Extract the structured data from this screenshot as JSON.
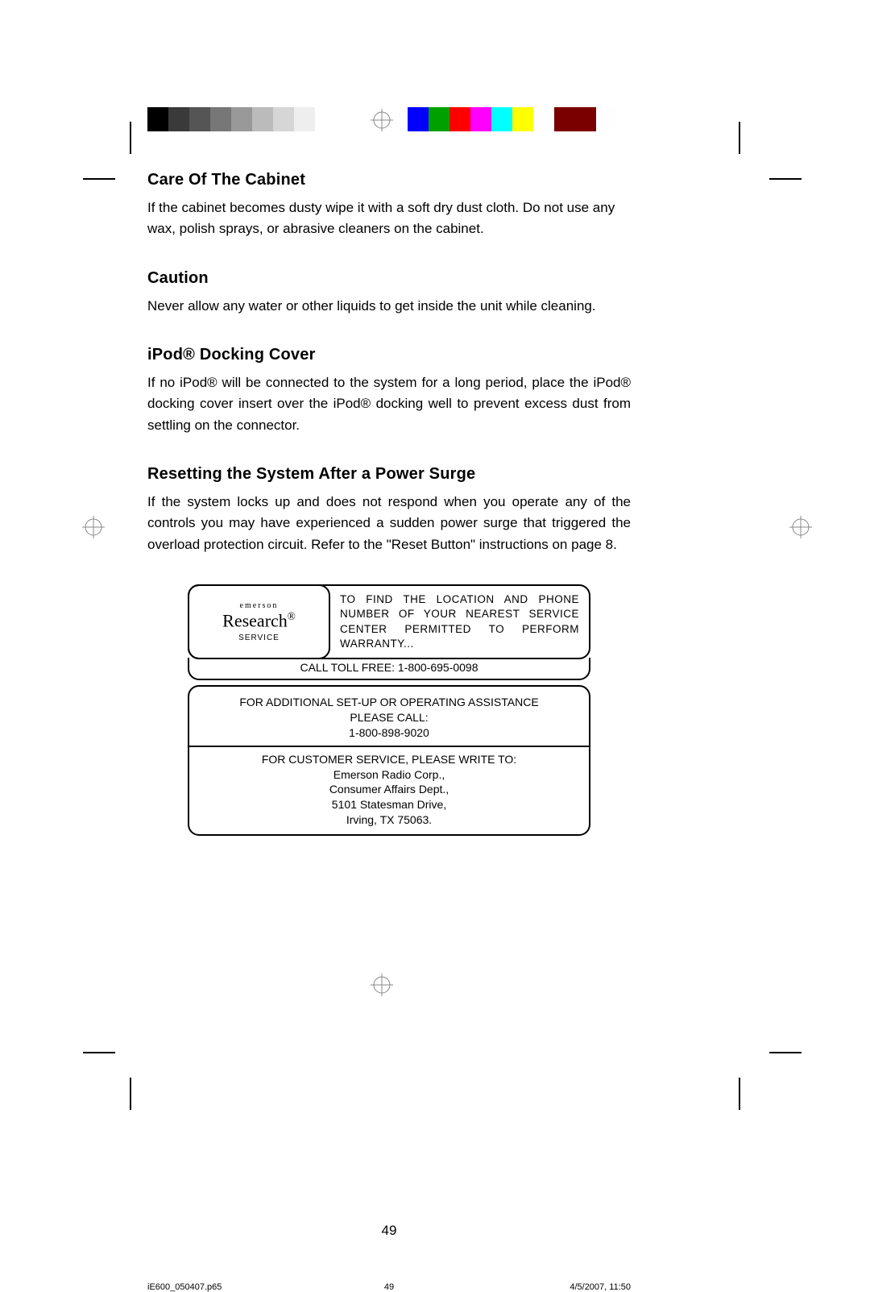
{
  "colors": {
    "left_bar": [
      "#000000",
      "#3a3a3a",
      "#555555",
      "#777777",
      "#999999",
      "#bbbbbb",
      "#d6d6d6",
      "#eeeeee",
      "#ffffff",
      "#ffffff"
    ],
    "right_bar": [
      "#0000ff",
      "#00a000",
      "#ff0000",
      "#ff00ff",
      "#00ffff",
      "#ffff00",
      "#ffffff",
      "#7a0000",
      "#7a0000",
      "#fefefe"
    ]
  },
  "sections": [
    {
      "heading": "Care Of The Cabinet",
      "body": "If the cabinet becomes dusty wipe it with a soft dry dust cloth.  Do not use any wax, polish sprays, or abrasive cleaners on the cabinet.",
      "justify": false
    },
    {
      "heading": "Caution",
      "body": "Never allow any water or other liquids to get inside the unit while cleaning.",
      "justify": false
    },
    {
      "heading": "iPod® Docking Cover",
      "body": "If no iPod® will be connected to the system for a long period, place the iPod® docking cover insert over the iPod® docking well to prevent excess dust from settling on the connector.",
      "justify": true
    },
    {
      "heading": "Resetting the System After a Power Surge",
      "body": "If the system locks up and does not respond when you operate any of the controls you may have experienced a sudden power surge that triggered the overload protection circuit.  Refer to the \"Reset Button\" instructions on page 8.",
      "justify": true
    }
  ],
  "service_box": {
    "logo": {
      "line1": "emerson",
      "line2": "Research",
      "reg": "®",
      "line3": "SERVICE"
    },
    "find_text": "TO FIND THE LOCATION AND PHONE NUMBER OF YOUR NEAREST SERVICE CENTER PERMITTED TO PERFORM WARRANTY...",
    "toll_free": "CALL TOLL FREE: 1-800-695-0098",
    "assist_l1": "FOR ADDITIONAL SET-UP OR OPERATING ASSISTANCE",
    "assist_l2": "PLEASE CALL:",
    "assist_l3": "1-800-898-9020",
    "addr_l1": "FOR CUSTOMER SERVICE, PLEASE WRITE TO:",
    "addr_l2": "Emerson Radio Corp.,",
    "addr_l3": "Consumer Affairs Dept.,",
    "addr_l4": "5101 Statesman Drive,",
    "addr_l5": "Irving, TX 75063."
  },
  "page_number": "49",
  "footer": {
    "filename": "iE600_050407.p65",
    "page": "49",
    "timestamp": "4/5/2007, 11:50"
  }
}
